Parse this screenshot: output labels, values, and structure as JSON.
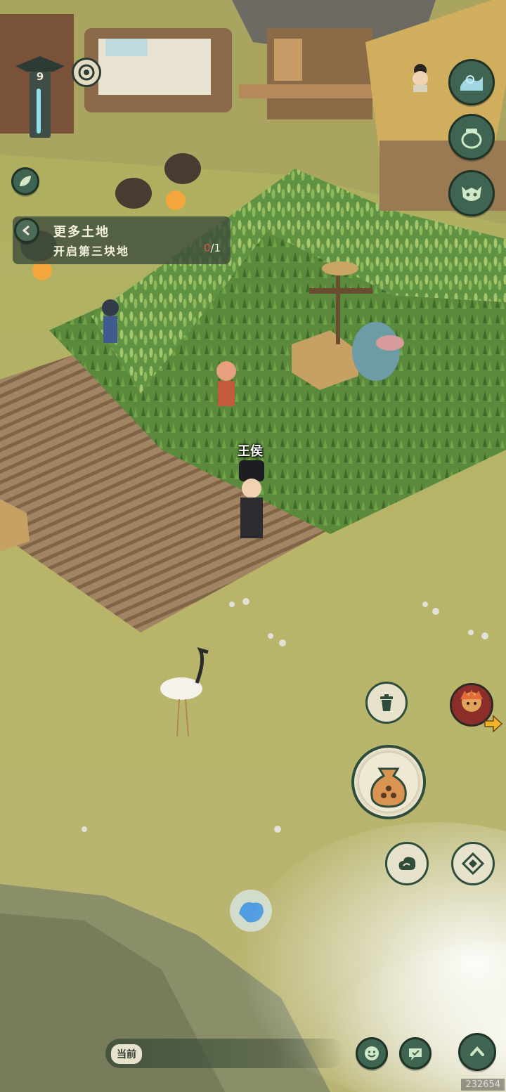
{
  "hud": {
    "level": "9"
  },
  "quest": {
    "title": "更多土地",
    "subtitle": "开启第三块地",
    "progress_current": "0",
    "progress_total": "/1"
  },
  "player": {
    "name": "王侯"
  },
  "chat": {
    "channel_label": "当前"
  },
  "watermark": "232654",
  "colors": {
    "button_dark": "#3f6552",
    "button_border": "#1f3327",
    "panel_bg": "#3e4e3a",
    "grass": "#b7b468",
    "soil": "#9b7c5c",
    "crop": "#4f7a34"
  },
  "icons": {
    "right_top": [
      "waves-icon",
      "pot-icon",
      "mask-icon"
    ],
    "action": [
      "trash-icon",
      "character-avatar-icon",
      "seed-bag-icon",
      "cloud-icon",
      "diamond-target-icon"
    ],
    "bottom": [
      "smile-icon",
      "chat-icon",
      "chevron-up-icon"
    ]
  }
}
